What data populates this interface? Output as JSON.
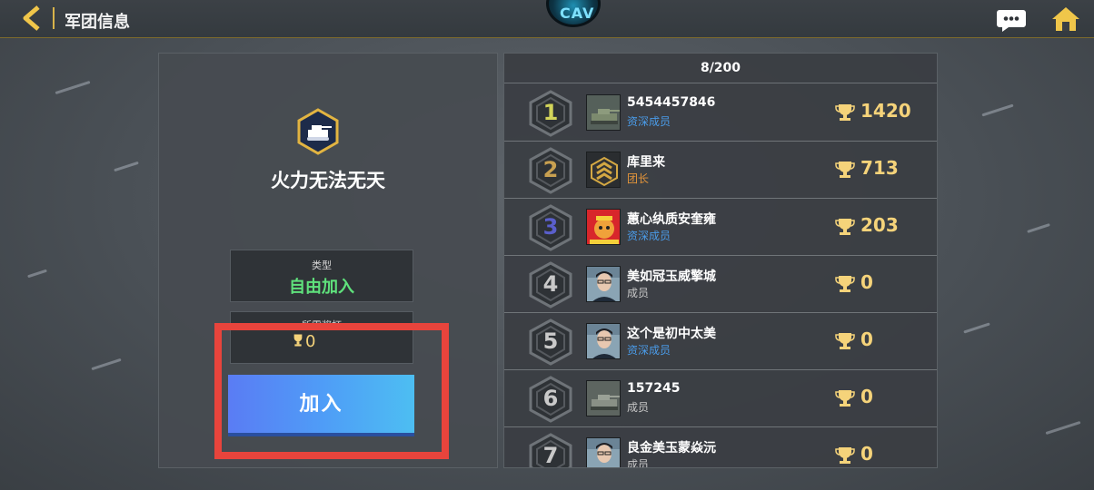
{
  "header": {
    "title": "军团信息",
    "logo_text": "CAV"
  },
  "clan": {
    "name": "火力无法无天",
    "type_label": "类型",
    "type_value": "自由加入",
    "requirement_label": "所需奖杯",
    "requirement_value": "0",
    "join_label": "加入"
  },
  "members": {
    "count": "8/200",
    "list": [
      {
        "rank": "1",
        "name": "5454457846",
        "role": "资深成员",
        "score": "1420"
      },
      {
        "rank": "2",
        "name": "库里来",
        "role": "团长",
        "score": "713"
      },
      {
        "rank": "3",
        "name": "蕙心纨质安奎雍",
        "role": "资深成员",
        "score": "203"
      },
      {
        "rank": "4",
        "name": "美如冠玉威擎城",
        "role": "成员",
        "score": "0"
      },
      {
        "rank": "5",
        "name": "这个是初中太美",
        "role": "资深成员",
        "score": "0"
      },
      {
        "rank": "6",
        "name": "157245",
        "role": "成员",
        "score": "0"
      },
      {
        "rank": "7",
        "name": "良金美玉蒙焱沅",
        "role": "成员",
        "score": "0"
      }
    ]
  },
  "colors": {
    "accent_gold": "#f5d37a",
    "join_green": "#5fe27c",
    "role_senior": "#4a9be8",
    "role_leader": "#e2943a",
    "role_member": "#c8c8c8",
    "highlight_red": "#e8443c"
  },
  "icons": {
    "back": "back-arrow-icon",
    "chat": "chat-bubble-icon",
    "home": "home-icon",
    "emblem": "tank-emblem-icon",
    "trophy": "trophy-icon"
  }
}
